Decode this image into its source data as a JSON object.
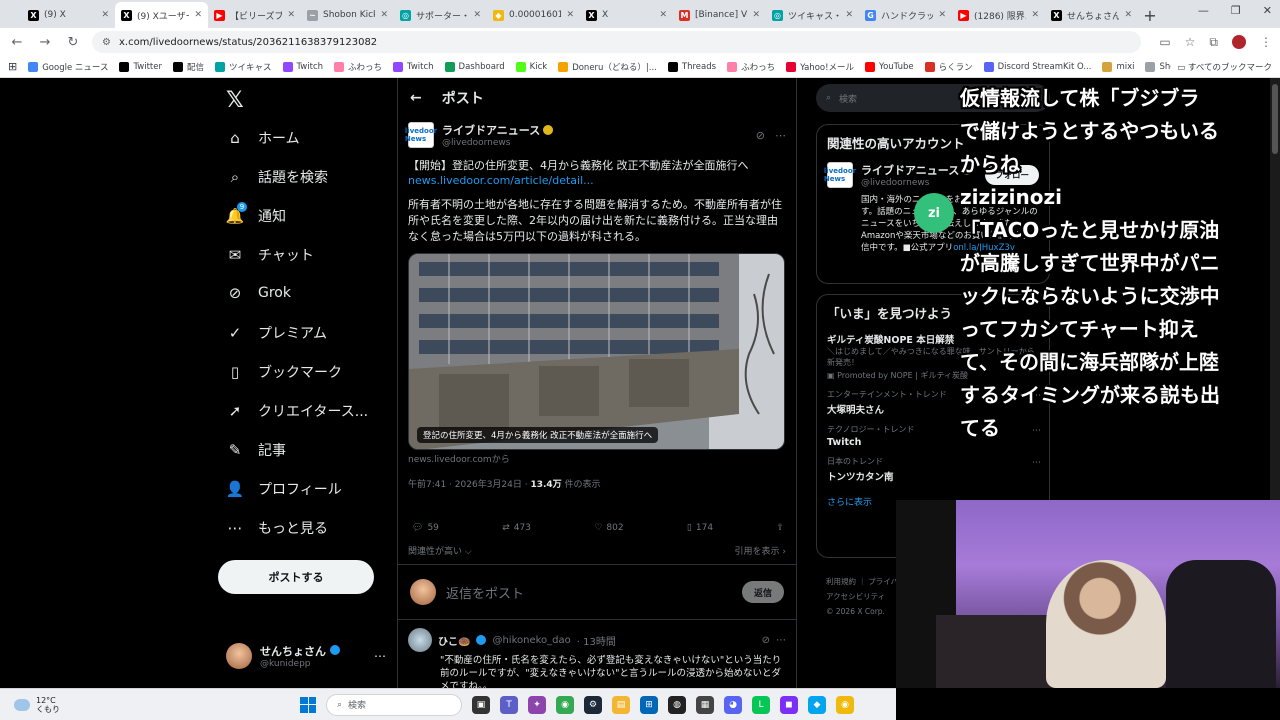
{
  "browser": {
    "tabs": [
      {
        "title": "(9) X",
        "color": "#000000",
        "glyph": "X",
        "active": false
      },
      {
        "title": "(9) Xユーザーの...",
        "color": "#000000",
        "glyph": "X",
        "active": true
      },
      {
        "title": "【ビリーズブートキ...",
        "color": "#ff0000",
        "glyph": "▶",
        "active": false
      },
      {
        "title": "Shobon Kick",
        "color": "#9aa0a6",
        "glyph": "~",
        "active": false
      },
      {
        "title": "サポーター・せ...",
        "color": "#00a3a3",
        "glyph": "◎",
        "active": false
      },
      {
        "title": "0.00001601",
        "color": "#f0b90b",
        "glyph": "◆",
        "active": false
      },
      {
        "title": "X",
        "color": "#000000",
        "glyph": "X",
        "active": false
      },
      {
        "title": "[Binance] Ve...",
        "color": "#d93025",
        "glyph": "M",
        "active": false
      },
      {
        "title": "ツイキャス・ラ...",
        "color": "#00a3a3",
        "glyph": "◎",
        "active": false
      },
      {
        "title": "ハンドクラップ",
        "color": "#4285f4",
        "glyph": "G",
        "active": false
      },
      {
        "title": "(1286) 限界...",
        "color": "#ff0000",
        "glyph": "▶",
        "active": false
      },
      {
        "title": "せんちょさん",
        "color": "#000000",
        "glyph": "X",
        "active": false
      }
    ],
    "url": "x.com/livedoornews/status/2036211638379123082",
    "bookmarks": [
      {
        "label": "Google ニュース",
        "color": "#4285f4"
      },
      {
        "label": "Twitter",
        "color": "#000000"
      },
      {
        "label": "配信",
        "color": "#000000"
      },
      {
        "label": "ツイキャス",
        "color": "#00a3a3"
      },
      {
        "label": "Twitch",
        "color": "#9146ff"
      },
      {
        "label": "ふわっち",
        "color": "#ff7fa7"
      },
      {
        "label": "Twitch",
        "color": "#9146ff"
      },
      {
        "label": "Dashboard",
        "color": "#0f9d58"
      },
      {
        "label": "Kick",
        "color": "#53fc18"
      },
      {
        "label": "Doneru（どねる）|...",
        "color": "#f4a300"
      },
      {
        "label": "Threads",
        "color": "#000000"
      },
      {
        "label": "ふわっち",
        "color": "#ff7fa7"
      },
      {
        "label": "Yahoo!メール",
        "color": "#e60033"
      },
      {
        "label": "YouTube",
        "color": "#ff0000"
      },
      {
        "label": "らくラン",
        "color": "#d93025"
      },
      {
        "label": "Discord StreamKit O...",
        "color": "#5865f2"
      },
      {
        "label": "mixi",
        "color": "#d4a33b"
      },
      {
        "label": "Shobon Kick Ranking",
        "color": "#9aa0a6"
      }
    ],
    "all_bookmarks": "すべてのブックマーク"
  },
  "nav": {
    "items": [
      {
        "label": "ホーム",
        "icon": "⌂",
        "name": "home"
      },
      {
        "label": "話題を検索",
        "icon": "⌕",
        "name": "explore"
      },
      {
        "label": "通知",
        "icon": "🔔",
        "name": "notifications",
        "badge": "9"
      },
      {
        "label": "チャット",
        "icon": "✉",
        "name": "chat"
      },
      {
        "label": "Grok",
        "icon": "⊘",
        "name": "grok"
      },
      {
        "label": "プレミアム",
        "icon": "✓",
        "name": "premium"
      },
      {
        "label": "ブックマーク",
        "icon": "▯",
        "name": "bookmarks"
      },
      {
        "label": "クリエイタース...",
        "icon": "➚",
        "name": "creator-studio"
      },
      {
        "label": "記事",
        "icon": "✎",
        "name": "articles"
      },
      {
        "label": "プロフィール",
        "icon": "👤",
        "name": "profile"
      },
      {
        "label": "もっと見る",
        "icon": "⋯",
        "name": "more"
      }
    ],
    "post_button": "ポストする",
    "account": {
      "name": "せんちょさん",
      "handle": "@kunidepp"
    }
  },
  "main": {
    "header": "ポスト",
    "tweet": {
      "name": "ライブドアニュース",
      "handle": "@livedoornews",
      "avatar_text": "livedoor News",
      "text1": "【開始】登記の住所変更、4月から義務化 改正不動産法が全面施行へ",
      "link": "news.livedoor.com/article/detail...",
      "text2": "所有者不明の土地が各地に存在する問題を解消するため。不動産所有者が住所や氏名を変更した際、2年以内の届け出を新たに義務付ける。正当な理由なく怠った場合は5万円以下の過料が科される。",
      "media_caption": "登記の住所変更、4月から義務化 改正不動産法が全面施行へ",
      "source": "news.livedoor.comから",
      "time": "午前7:41 · 2026年3月24日 · ",
      "views": "13.4万",
      "views_suffix": " 件の表示",
      "replies": "59",
      "reposts": "473",
      "likes": "802",
      "bookmarks": "174",
      "relevance": "関連性が高い ⌵",
      "quotes": "引用を表示 ›"
    },
    "reply_placeholder": "返信をポスト",
    "reply_button": "返信",
    "reply": {
      "name": "ひこ🍩",
      "handle": "@hikoneko_dao",
      "time": "· 13時間",
      "text": "\"不動産の住所・氏名を変えたら、必ず登記も変えなきゃいけない\"という当たり前のルールですが、\"変えなきゃいけない\"と言うルールの浸透から始めないとダメですね。。"
    }
  },
  "right": {
    "search_placeholder": "検索",
    "related_title": "関連性の高いアカウント",
    "related": {
      "name": "ライブドアニュース",
      "handle": "@livedoornews",
      "follow": "フォロー",
      "bio": "国内・海外のニュースをお届けするメディアです。話題のニュースから、あらゆるジャンルのニュースをいち早くお伝えします。また、Amazonや楽天市場などのお買い物情報も発信中です。■公式アプリ",
      "bio_link": "onl.la/JHuxZ3v"
    },
    "now_title": "「いま」を見つけよう",
    "trends": [
      {
        "category": "",
        "title": "ギルティ炭酸NOPE 本日解禁",
        "desc": "＼はじめまして／やみつきになる罪な味、サントリーから新発売！",
        "promo": "Promoted by NOPE | ギルティ炭酸"
      },
      {
        "category": "エンターテインメント・トレンド",
        "title": "大塚明夫さん"
      },
      {
        "category": "テクノロジー・トレンド",
        "title": "Twitch"
      },
      {
        "category": "日本のトレンド",
        "title": "トンツカタン南"
      }
    ],
    "show_more": "さらに表示",
    "footer1": "利用規約 ｜ プライバシーポリシー",
    "footer2": "アクセシビリティ",
    "footer3": "© 2026 X Corp."
  },
  "overlay": {
    "lines": [
      "仮情報流して株「ブジブラ",
      "で儲けようとするやつもいる",
      "からね",
      "zizizinozi",
      "「TACOったと見せかけ原油",
      "が高騰しすぎて世界中がパニ",
      "ックにならないように交渉中",
      "ってフカシてチャート抑え",
      "て、その間に海兵部隊が上陸",
      "するタイミングが来る説も出",
      "てる"
    ],
    "avatar": "zi"
  },
  "taskbar": {
    "temp": "12°C",
    "weather": "くもり",
    "search": "検索"
  }
}
